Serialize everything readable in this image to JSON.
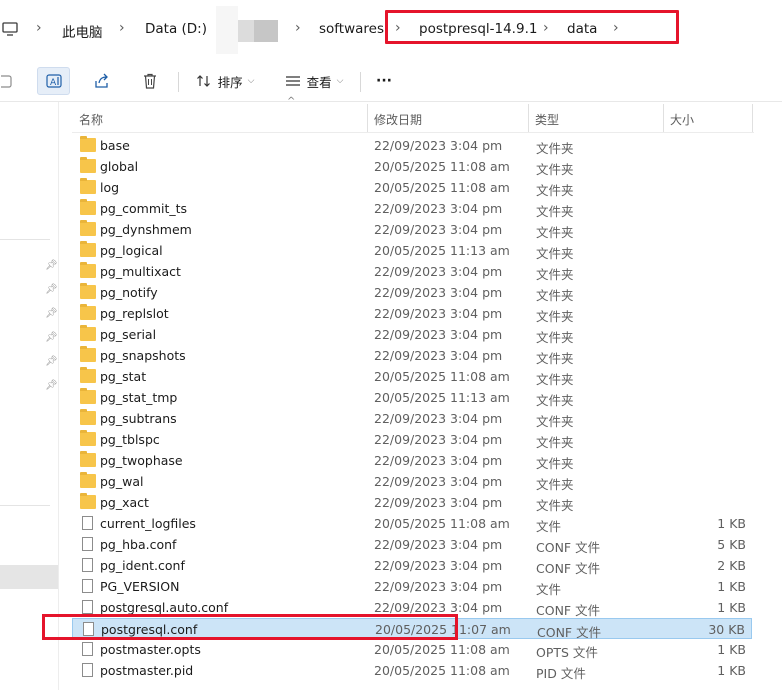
{
  "breadcrumb": {
    "items": [
      {
        "label": "此电脑"
      },
      {
        "label": "Data (D:)"
      },
      {
        "label": "softwares"
      },
      {
        "label": "postpresql-14.9.1"
      },
      {
        "label": "data"
      }
    ]
  },
  "toolbar": {
    "sort_label": "排序",
    "view_label": "查看",
    "more_label": "···"
  },
  "columns": {
    "name": "名称",
    "modified": "修改日期",
    "type": "类型",
    "size": "大小"
  },
  "files": [
    {
      "name": "base",
      "modified": "22/09/2023 3:04 pm",
      "type": "文件夹",
      "size": "",
      "kind": "folder"
    },
    {
      "name": "global",
      "modified": "20/05/2025 11:08 am",
      "type": "文件夹",
      "size": "",
      "kind": "folder"
    },
    {
      "name": "log",
      "modified": "20/05/2025 11:08 am",
      "type": "文件夹",
      "size": "",
      "kind": "folder"
    },
    {
      "name": "pg_commit_ts",
      "modified": "22/09/2023 3:04 pm",
      "type": "文件夹",
      "size": "",
      "kind": "folder"
    },
    {
      "name": "pg_dynshmem",
      "modified": "22/09/2023 3:04 pm",
      "type": "文件夹",
      "size": "",
      "kind": "folder"
    },
    {
      "name": "pg_logical",
      "modified": "20/05/2025 11:13 am",
      "type": "文件夹",
      "size": "",
      "kind": "folder"
    },
    {
      "name": "pg_multixact",
      "modified": "22/09/2023 3:04 pm",
      "type": "文件夹",
      "size": "",
      "kind": "folder"
    },
    {
      "name": "pg_notify",
      "modified": "22/09/2023 3:04 pm",
      "type": "文件夹",
      "size": "",
      "kind": "folder"
    },
    {
      "name": "pg_replslot",
      "modified": "22/09/2023 3:04 pm",
      "type": "文件夹",
      "size": "",
      "kind": "folder"
    },
    {
      "name": "pg_serial",
      "modified": "22/09/2023 3:04 pm",
      "type": "文件夹",
      "size": "",
      "kind": "folder"
    },
    {
      "name": "pg_snapshots",
      "modified": "22/09/2023 3:04 pm",
      "type": "文件夹",
      "size": "",
      "kind": "folder"
    },
    {
      "name": "pg_stat",
      "modified": "20/05/2025 11:08 am",
      "type": "文件夹",
      "size": "",
      "kind": "folder"
    },
    {
      "name": "pg_stat_tmp",
      "modified": "20/05/2025 11:13 am",
      "type": "文件夹",
      "size": "",
      "kind": "folder"
    },
    {
      "name": "pg_subtrans",
      "modified": "22/09/2023 3:04 pm",
      "type": "文件夹",
      "size": "",
      "kind": "folder"
    },
    {
      "name": "pg_tblspc",
      "modified": "22/09/2023 3:04 pm",
      "type": "文件夹",
      "size": "",
      "kind": "folder"
    },
    {
      "name": "pg_twophase",
      "modified": "22/09/2023 3:04 pm",
      "type": "文件夹",
      "size": "",
      "kind": "folder"
    },
    {
      "name": "pg_wal",
      "modified": "22/09/2023 3:04 pm",
      "type": "文件夹",
      "size": "",
      "kind": "folder"
    },
    {
      "name": "pg_xact",
      "modified": "22/09/2023 3:04 pm",
      "type": "文件夹",
      "size": "",
      "kind": "folder"
    },
    {
      "name": "current_logfiles",
      "modified": "20/05/2025 11:08 am",
      "type": "文件",
      "size": "1 KB",
      "kind": "file"
    },
    {
      "name": "pg_hba.conf",
      "modified": "22/09/2023 3:04 pm",
      "type": "CONF 文件",
      "size": "5 KB",
      "kind": "file"
    },
    {
      "name": "pg_ident.conf",
      "modified": "22/09/2023 3:04 pm",
      "type": "CONF 文件",
      "size": "2 KB",
      "kind": "file"
    },
    {
      "name": "PG_VERSION",
      "modified": "22/09/2023 3:04 pm",
      "type": "文件",
      "size": "1 KB",
      "kind": "file"
    },
    {
      "name": "postgresql.auto.conf",
      "modified": "22/09/2023 3:04 pm",
      "type": "CONF 文件",
      "size": "1 KB",
      "kind": "file"
    },
    {
      "name": "postgresql.conf",
      "modified": "20/05/2025 11:07 am",
      "type": "CONF 文件",
      "size": "30 KB",
      "kind": "file",
      "selected": true
    },
    {
      "name": "postmaster.opts",
      "modified": "20/05/2025 11:08 am",
      "type": "OPTS 文件",
      "size": "1 KB",
      "kind": "file"
    },
    {
      "name": "postmaster.pid",
      "modified": "20/05/2025 11:08 am",
      "type": "PID 文件",
      "size": "1 KB",
      "kind": "file"
    }
  ],
  "colors": {
    "highlight": "#e5142b",
    "selection": "#cce4f7",
    "folder": "#f7c54a"
  }
}
